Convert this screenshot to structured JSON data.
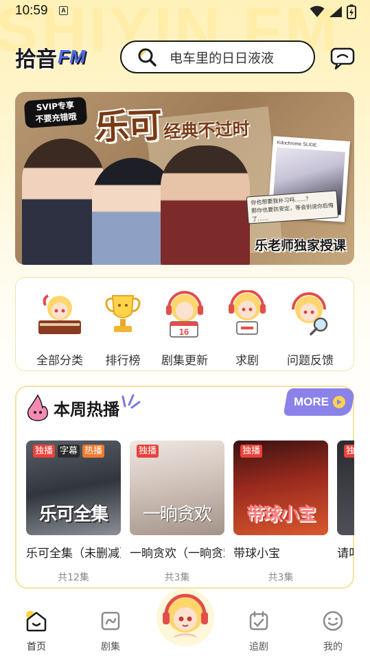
{
  "status_bar": {
    "time": "10:59",
    "notification_badge": "A"
  },
  "header": {
    "logo_cn": "拾音",
    "logo_en": "FM",
    "search_placeholder": "电车里的日日液液",
    "watermark": "SHIYIN FM"
  },
  "banner": {
    "svip_line1": "SVIP专享",
    "svip_line2": "不要充错哦",
    "title_main": "乐可",
    "title_sub": "经典不过时",
    "polaroid_caption": "Kdochrome SLIDE",
    "note_line1": "你也想要我补习吗……？",
    "note_line2": "那你也要防安定，等会别说你后悔了……",
    "footer": "乐老师独家授课"
  },
  "quick_menu": {
    "items": [
      {
        "label": "全部分类",
        "icon": "books-mascot-icon"
      },
      {
        "label": "排行榜",
        "icon": "trophy-icon"
      },
      {
        "label": "剧集更新",
        "icon": "calendar-mascot-icon"
      },
      {
        "label": "求剧",
        "icon": "request-mascot-icon"
      },
      {
        "label": "问题反馈",
        "icon": "magnifier-mascot-icon"
      }
    ]
  },
  "weekly_hot": {
    "title": "本周热播",
    "more_label": "MORE",
    "dramas": [
      {
        "name": "乐可全集（未删减）",
        "eps": "共12集",
        "cover_text": "乐可全集",
        "tags": [
          "独播",
          "字幕",
          "热播"
        ]
      },
      {
        "name": "一晌贪欢（一晌贪欢）",
        "eps": "共3集",
        "cover_text": "一晌贪欢",
        "tags": [
          "独播"
        ]
      },
      {
        "name": "带球小宝",
        "eps": "共3集",
        "cover_text": "带球小宝",
        "tags": [
          "独播"
        ]
      },
      {
        "name": "请叫",
        "eps": "",
        "cover_text": "",
        "tags": [
          "独"
        ]
      }
    ]
  },
  "bottom_nav": {
    "items": [
      {
        "label": "首页",
        "icon": "home-icon",
        "active": true
      },
      {
        "label": "剧集",
        "icon": "drama-icon",
        "active": false
      },
      {
        "label": "追剧",
        "icon": "follow-icon",
        "active": false
      },
      {
        "label": "我的",
        "icon": "profile-icon",
        "active": false
      }
    ]
  },
  "colors": {
    "accent_yellow": "#ffd34a",
    "more_purple": "#8a82e8",
    "tag_red": "#e8423a",
    "search_border": "#1a1a1a"
  }
}
